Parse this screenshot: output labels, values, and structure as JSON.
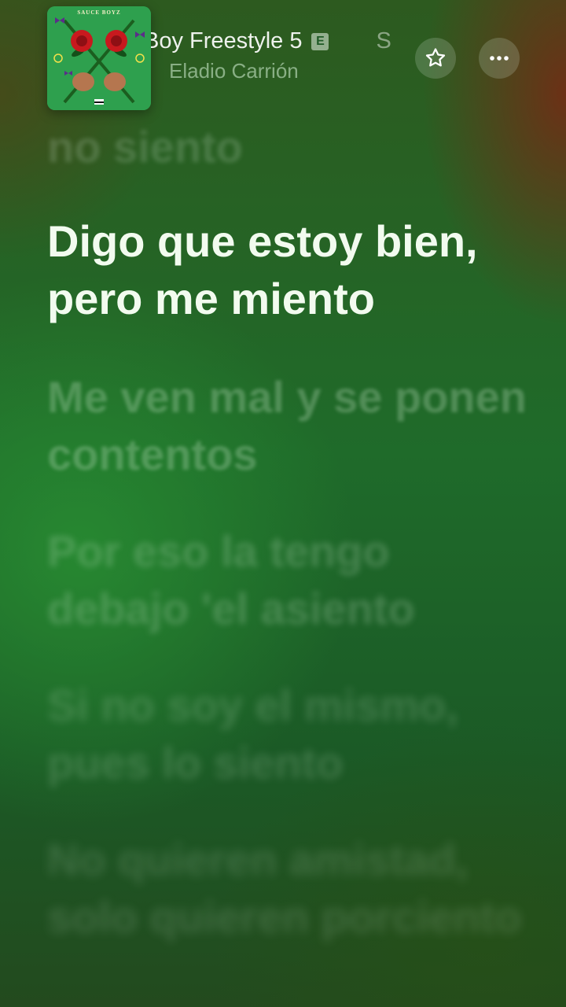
{
  "now_playing": {
    "title": "Boy Freestyle 5",
    "title_tail": "S",
    "explicit_badge": "E",
    "artist": "Eladio Carrión",
    "artwork_text": "SAUCE BOYZ",
    "favorite_icon": "star-icon",
    "more_icon": "ellipsis-icon"
  },
  "lyrics": {
    "previous": "no siento",
    "current": "Digo que estoy bien, pero me miento",
    "upcoming": [
      "Me ven mal y se ponen contentos",
      "Por eso la tengo debajo 'el asiento",
      "Si no soy el mismo, pues lo siento",
      "No quieren amistad, solo quieren porciento"
    ]
  },
  "colors": {
    "background_green": "#1f6b2a",
    "accent_red": "#7a2814",
    "active_lyric": "#f2fbef"
  }
}
